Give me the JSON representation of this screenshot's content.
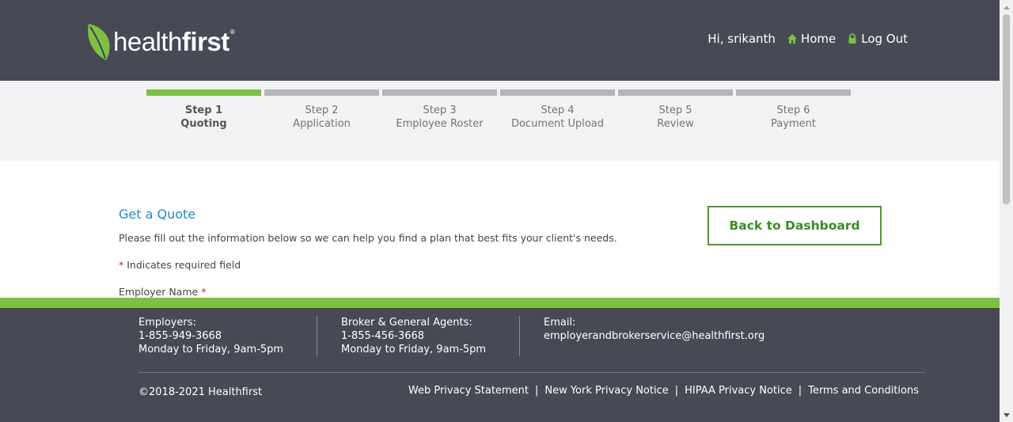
{
  "header": {
    "logo_light": "health",
    "logo_bold": "first",
    "logo_reg": "®",
    "greeting": "Hi, srikanth",
    "home_label": "Home",
    "logout_label": "Log Out"
  },
  "steps": [
    {
      "number": "Step 1",
      "name": "Quoting",
      "active": true
    },
    {
      "number": "Step 2",
      "name": "Application",
      "active": false
    },
    {
      "number": "Step 3",
      "name": "Employee Roster",
      "active": false
    },
    {
      "number": "Step 4",
      "name": "Document Upload",
      "active": false
    },
    {
      "number": "Step 5",
      "name": "Review",
      "active": false
    },
    {
      "number": "Step 6",
      "name": "Payment",
      "active": false
    }
  ],
  "main": {
    "title": "Get a Quote",
    "intro": "Please fill out the information below so we can help you find a plan that best fits your client's needs.",
    "required_star": "*",
    "required_note": "Indicates required field",
    "employer_label": "Employer Name",
    "back_button": "Back to Dashboard"
  },
  "footer": {
    "employers": {
      "heading": "Employers:",
      "phone": "1-855-949-3668",
      "hours": "Monday to Friday, 9am-5pm"
    },
    "brokers": {
      "heading": "Broker & General Agents:",
      "phone": "1-855-456-3668",
      "hours": "Monday to Friday, 9am-5pm"
    },
    "email": {
      "heading": "Email:",
      "address": "employerandbrokerservice@healthfirst.org"
    },
    "copyright": "©2018-2021 Healthfirst",
    "links": [
      "Web Privacy Statement",
      "New York Privacy Notice",
      "HIPAA Privacy Notice",
      "Terms and Conditions"
    ]
  },
  "colors": {
    "header_bg": "#474a54",
    "accent_green": "#7cc142",
    "button_green": "#4b9a2f",
    "title_blue": "#1d8ac7",
    "step_inactive": "#b5b6b8"
  },
  "icons": {
    "logo": "leaf-icon",
    "home": "home-icon",
    "logout": "lock-icon"
  }
}
